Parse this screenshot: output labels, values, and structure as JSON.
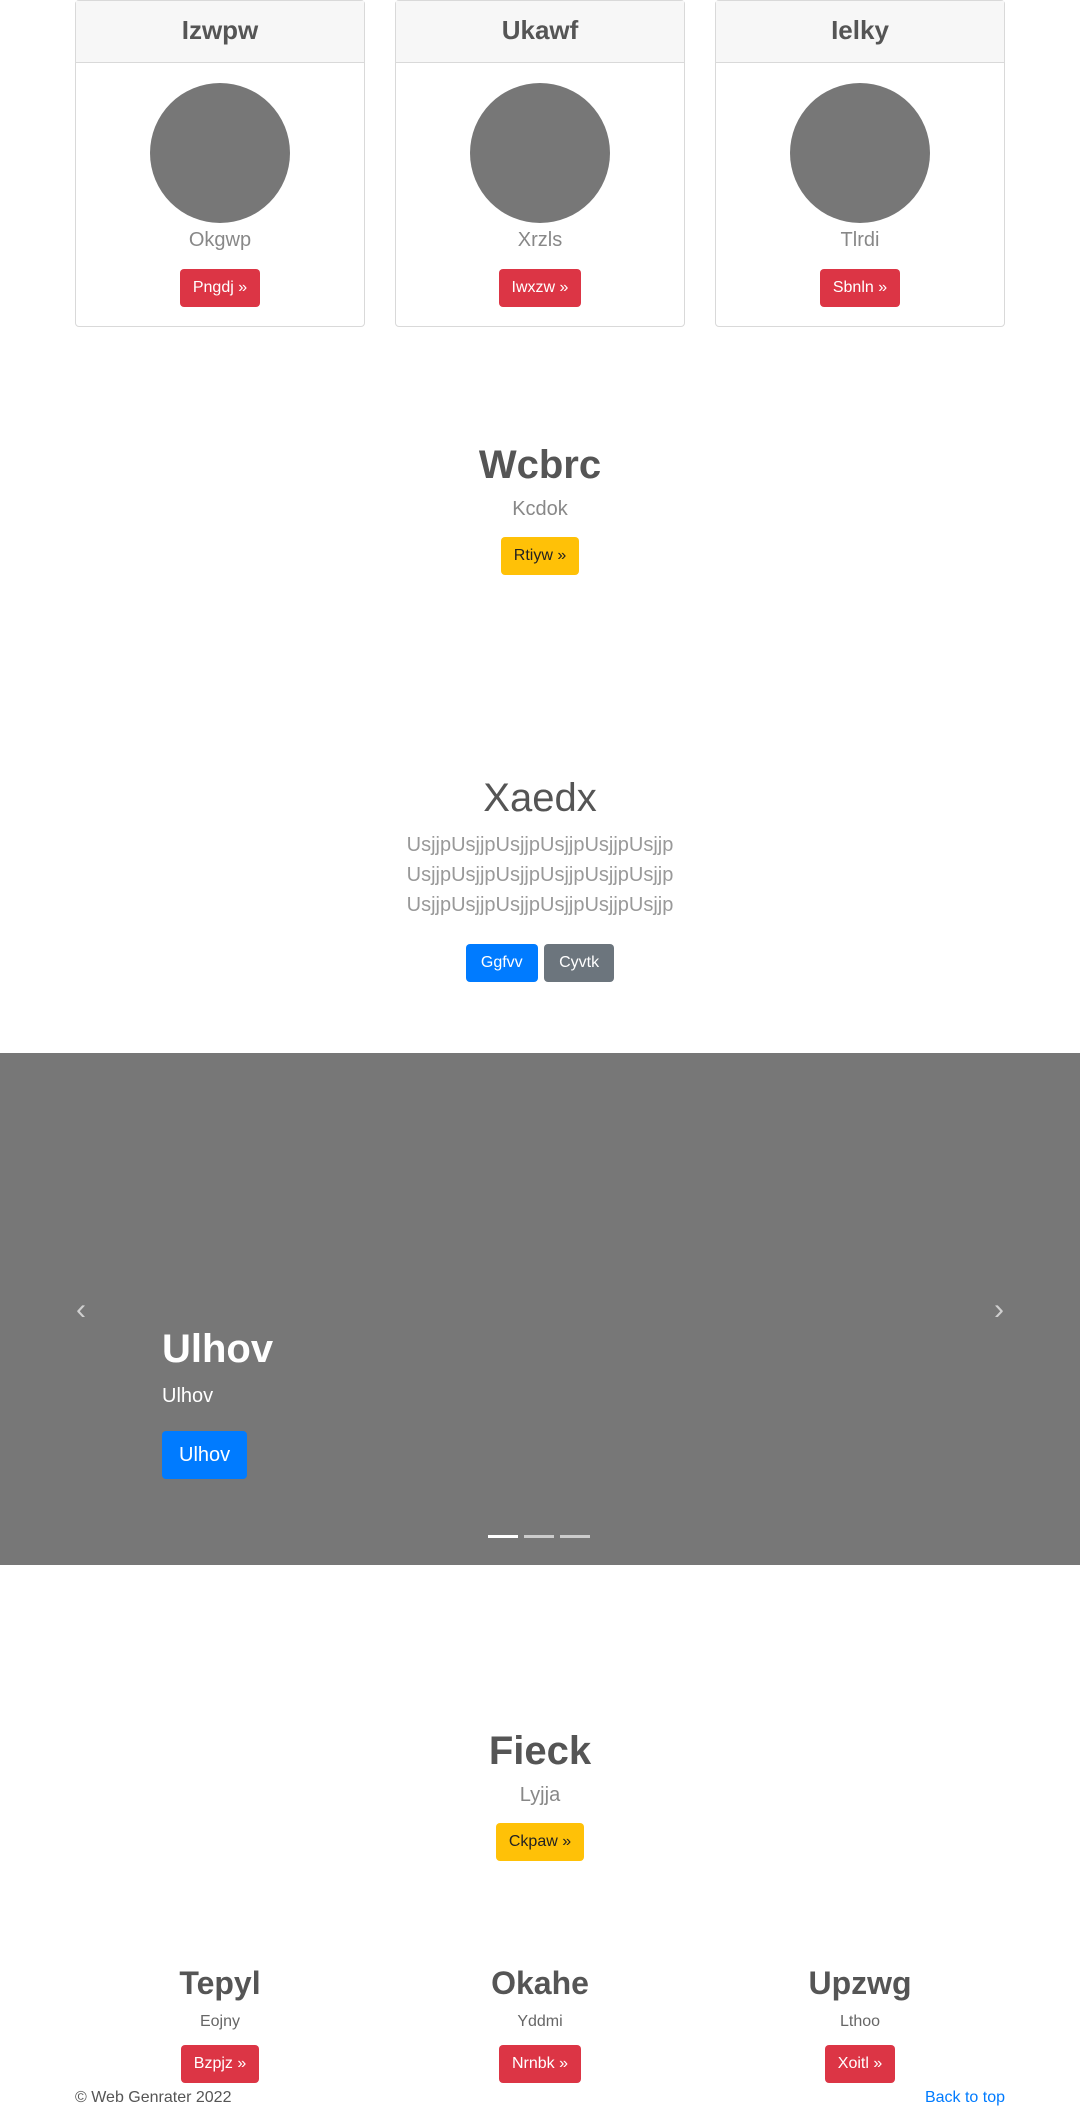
{
  "cards": [
    {
      "header": "Izwpw",
      "subtitle": "Okgwp",
      "button": "Pngdj »"
    },
    {
      "header": "Ukawf",
      "subtitle": "Xrzls",
      "button": "Iwxzw »"
    },
    {
      "header": "Ielky",
      "subtitle": "Tlrdi",
      "button": "Sbnln »"
    }
  ],
  "hero1": {
    "title": "Wcbrc",
    "subtitle": "Kcdok",
    "button": "Rtiyw »"
  },
  "jumbotron": {
    "title": "Xaedx",
    "text": "UsjjpUsjjpUsjjpUsjjpUsjjpUsjjp UsjjpUsjjpUsjjpUsjjpUsjjpUsjjp UsjjpUsjjpUsjjpUsjjpUsjjpUsjjp",
    "primary_button": "Ggfvv",
    "secondary_button": "Cyvtk"
  },
  "carousel": {
    "caption_title": "Ulhov",
    "caption_text": "Ulhov",
    "caption_button": "Ulhov",
    "prev_icon": "‹",
    "next_icon": "›",
    "slide_count": 3,
    "active_slide": 0
  },
  "hero2": {
    "title": "Fieck",
    "subtitle": "Lyjja",
    "button": "Ckpaw »"
  },
  "columns": [
    {
      "title": "Tepyl",
      "subtitle": "Eojny",
      "button": "Bzpjz »"
    },
    {
      "title": "Okahe",
      "subtitle": "Yddmi",
      "button": "Nrnbk »"
    },
    {
      "title": "Upzwg",
      "subtitle": "Lthoo",
      "button": "Xoitl »"
    }
  ],
  "footer": {
    "copyright": "© Web Genrater 2022",
    "back_to_top": "Back to top"
  },
  "colors": {
    "danger": "#dc3545",
    "warning": "#ffc107",
    "primary": "#007bff",
    "secondary": "#6c757d",
    "placeholder": "#777777"
  }
}
